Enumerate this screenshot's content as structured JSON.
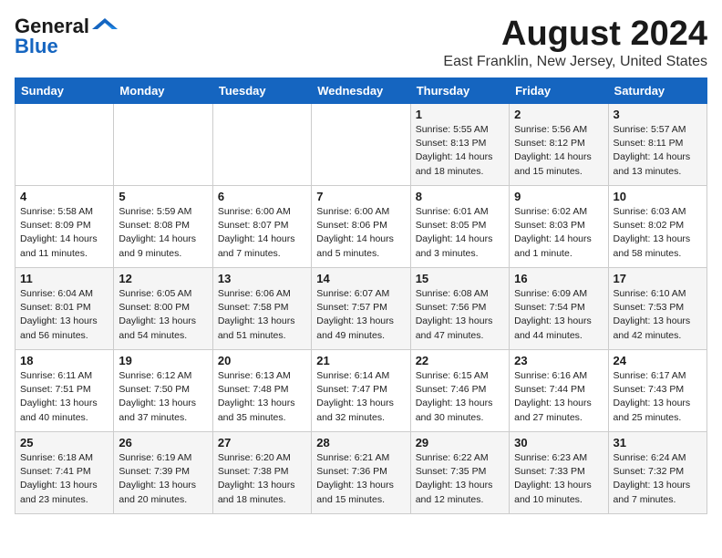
{
  "logo": {
    "line1": "General",
    "line2": "Blue",
    "tagline": ""
  },
  "title": "August 2024",
  "subtitle": "East Franklin, New Jersey, United States",
  "weekdays": [
    "Sunday",
    "Monday",
    "Tuesday",
    "Wednesday",
    "Thursday",
    "Friday",
    "Saturday"
  ],
  "weeks": [
    [
      {
        "day": "",
        "info": ""
      },
      {
        "day": "",
        "info": ""
      },
      {
        "day": "",
        "info": ""
      },
      {
        "day": "",
        "info": ""
      },
      {
        "day": "1",
        "info": "Sunrise: 5:55 AM\nSunset: 8:13 PM\nDaylight: 14 hours\nand 18 minutes."
      },
      {
        "day": "2",
        "info": "Sunrise: 5:56 AM\nSunset: 8:12 PM\nDaylight: 14 hours\nand 15 minutes."
      },
      {
        "day": "3",
        "info": "Sunrise: 5:57 AM\nSunset: 8:11 PM\nDaylight: 14 hours\nand 13 minutes."
      }
    ],
    [
      {
        "day": "4",
        "info": "Sunrise: 5:58 AM\nSunset: 8:09 PM\nDaylight: 14 hours\nand 11 minutes."
      },
      {
        "day": "5",
        "info": "Sunrise: 5:59 AM\nSunset: 8:08 PM\nDaylight: 14 hours\nand 9 minutes."
      },
      {
        "day": "6",
        "info": "Sunrise: 6:00 AM\nSunset: 8:07 PM\nDaylight: 14 hours\nand 7 minutes."
      },
      {
        "day": "7",
        "info": "Sunrise: 6:00 AM\nSunset: 8:06 PM\nDaylight: 14 hours\nand 5 minutes."
      },
      {
        "day": "8",
        "info": "Sunrise: 6:01 AM\nSunset: 8:05 PM\nDaylight: 14 hours\nand 3 minutes."
      },
      {
        "day": "9",
        "info": "Sunrise: 6:02 AM\nSunset: 8:03 PM\nDaylight: 14 hours\nand 1 minute."
      },
      {
        "day": "10",
        "info": "Sunrise: 6:03 AM\nSunset: 8:02 PM\nDaylight: 13 hours\nand 58 minutes."
      }
    ],
    [
      {
        "day": "11",
        "info": "Sunrise: 6:04 AM\nSunset: 8:01 PM\nDaylight: 13 hours\nand 56 minutes."
      },
      {
        "day": "12",
        "info": "Sunrise: 6:05 AM\nSunset: 8:00 PM\nDaylight: 13 hours\nand 54 minutes."
      },
      {
        "day": "13",
        "info": "Sunrise: 6:06 AM\nSunset: 7:58 PM\nDaylight: 13 hours\nand 51 minutes."
      },
      {
        "day": "14",
        "info": "Sunrise: 6:07 AM\nSunset: 7:57 PM\nDaylight: 13 hours\nand 49 minutes."
      },
      {
        "day": "15",
        "info": "Sunrise: 6:08 AM\nSunset: 7:56 PM\nDaylight: 13 hours\nand 47 minutes."
      },
      {
        "day": "16",
        "info": "Sunrise: 6:09 AM\nSunset: 7:54 PM\nDaylight: 13 hours\nand 44 minutes."
      },
      {
        "day": "17",
        "info": "Sunrise: 6:10 AM\nSunset: 7:53 PM\nDaylight: 13 hours\nand 42 minutes."
      }
    ],
    [
      {
        "day": "18",
        "info": "Sunrise: 6:11 AM\nSunset: 7:51 PM\nDaylight: 13 hours\nand 40 minutes."
      },
      {
        "day": "19",
        "info": "Sunrise: 6:12 AM\nSunset: 7:50 PM\nDaylight: 13 hours\nand 37 minutes."
      },
      {
        "day": "20",
        "info": "Sunrise: 6:13 AM\nSunset: 7:48 PM\nDaylight: 13 hours\nand 35 minutes."
      },
      {
        "day": "21",
        "info": "Sunrise: 6:14 AM\nSunset: 7:47 PM\nDaylight: 13 hours\nand 32 minutes."
      },
      {
        "day": "22",
        "info": "Sunrise: 6:15 AM\nSunset: 7:46 PM\nDaylight: 13 hours\nand 30 minutes."
      },
      {
        "day": "23",
        "info": "Sunrise: 6:16 AM\nSunset: 7:44 PM\nDaylight: 13 hours\nand 27 minutes."
      },
      {
        "day": "24",
        "info": "Sunrise: 6:17 AM\nSunset: 7:43 PM\nDaylight: 13 hours\nand 25 minutes."
      }
    ],
    [
      {
        "day": "25",
        "info": "Sunrise: 6:18 AM\nSunset: 7:41 PM\nDaylight: 13 hours\nand 23 minutes."
      },
      {
        "day": "26",
        "info": "Sunrise: 6:19 AM\nSunset: 7:39 PM\nDaylight: 13 hours\nand 20 minutes."
      },
      {
        "day": "27",
        "info": "Sunrise: 6:20 AM\nSunset: 7:38 PM\nDaylight: 13 hours\nand 18 minutes."
      },
      {
        "day": "28",
        "info": "Sunrise: 6:21 AM\nSunset: 7:36 PM\nDaylight: 13 hours\nand 15 minutes."
      },
      {
        "day": "29",
        "info": "Sunrise: 6:22 AM\nSunset: 7:35 PM\nDaylight: 13 hours\nand 12 minutes."
      },
      {
        "day": "30",
        "info": "Sunrise: 6:23 AM\nSunset: 7:33 PM\nDaylight: 13 hours\nand 10 minutes."
      },
      {
        "day": "31",
        "info": "Sunrise: 6:24 AM\nSunset: 7:32 PM\nDaylight: 13 hours\nand 7 minutes."
      }
    ]
  ]
}
